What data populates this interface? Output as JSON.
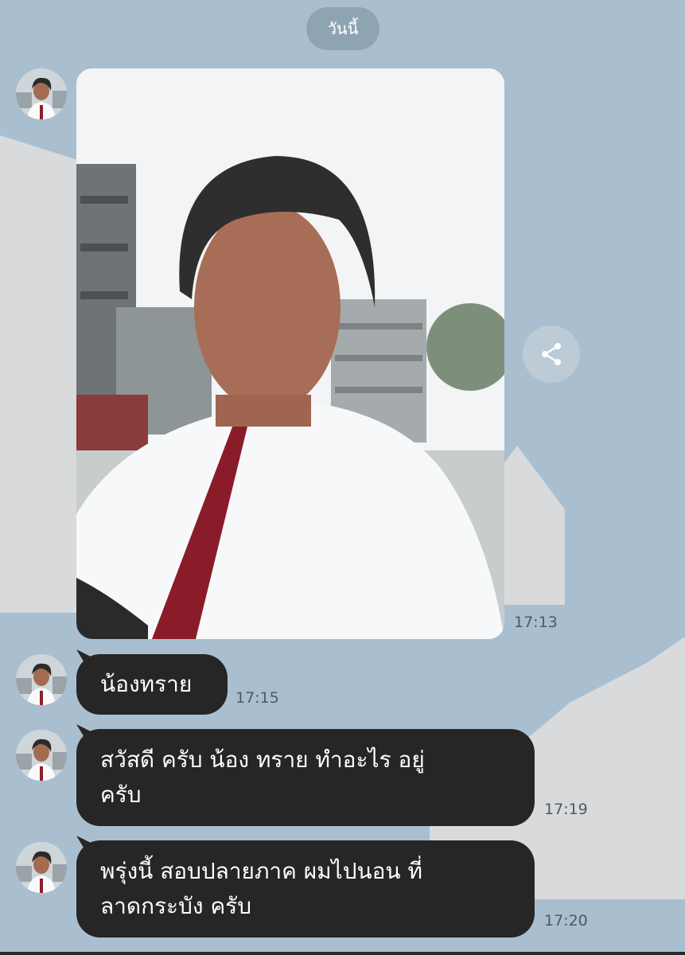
{
  "date_divider": "วันนี้",
  "messages": [
    {
      "type": "image",
      "time": "17:13"
    },
    {
      "type": "text",
      "lines": [
        "น้องทราย"
      ],
      "time": "17:15"
    },
    {
      "type": "text",
      "lines": [
        "สวัสดี  ครับ  น้อง ทราย  ทำอะไร อยู่",
        "ครับ"
      ],
      "time": "17:19"
    },
    {
      "type": "text",
      "lines": [
        "พรุ่งนี้  สอบปลายภาค  ผมไปนอน ที่",
        "ลาดกระบัง  ครับ"
      ],
      "time": "17:20"
    }
  ],
  "icons": {
    "share": "share-icon",
    "avatar": "avatar-photo"
  },
  "colors": {
    "background": "#a9bfd0",
    "bubble": "#262626",
    "pill": "#8fa4b3"
  }
}
